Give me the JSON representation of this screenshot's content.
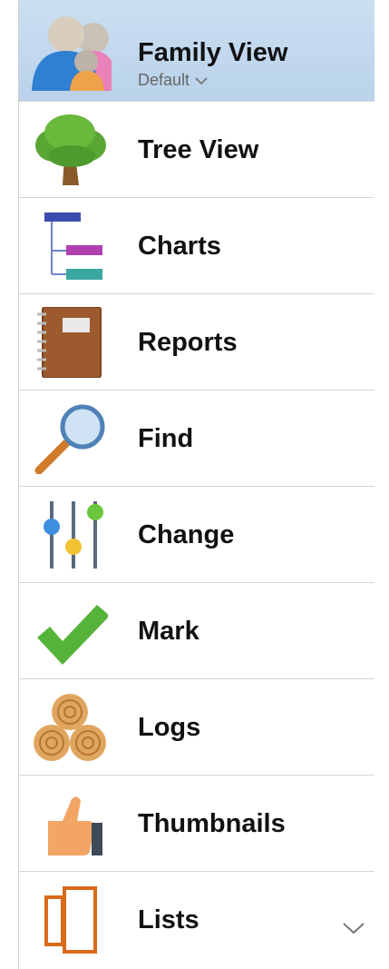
{
  "sidebar": {
    "items": [
      {
        "label": "Family View",
        "sub": "Default",
        "icon": "family-icon",
        "selected": true
      },
      {
        "label": "Tree View",
        "icon": "tree-icon"
      },
      {
        "label": "Charts",
        "icon": "charts-icon"
      },
      {
        "label": "Reports",
        "icon": "notebook-icon"
      },
      {
        "label": "Find",
        "icon": "magnifier-icon"
      },
      {
        "label": "Change",
        "icon": "sliders-icon"
      },
      {
        "label": "Mark",
        "icon": "checkmark-icon"
      },
      {
        "label": "Logs",
        "icon": "logs-icon"
      },
      {
        "label": "Thumbnails",
        "icon": "thumbs-up-icon"
      },
      {
        "label": "Lists",
        "icon": "lists-icon"
      }
    ]
  },
  "colors": {
    "selected_bg": "#c3d9ef",
    "divider": "#d6d6d6"
  }
}
